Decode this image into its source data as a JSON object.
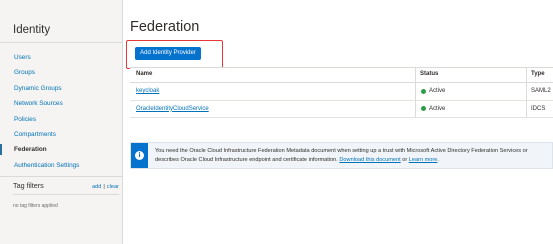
{
  "sidebar": {
    "title": "Identity",
    "items": [
      {
        "label": "Users"
      },
      {
        "label": "Groups"
      },
      {
        "label": "Dynamic Groups"
      },
      {
        "label": "Network Sources"
      },
      {
        "label": "Policies"
      },
      {
        "label": "Compartments"
      },
      {
        "label": "Federation",
        "active": true
      },
      {
        "label": "Authentication Settings"
      }
    ],
    "tag_filters": {
      "title": "Tag filters",
      "add_label": "add",
      "separator": "|",
      "clear_label": "clear",
      "empty_text": "no tag filters applied"
    }
  },
  "main": {
    "title": "Federation",
    "add_button_label": "Add Identity Provider",
    "table": {
      "columns": [
        "Name",
        "Status",
        "Type"
      ],
      "rows": [
        {
          "name": "keycloak",
          "status": "Active",
          "type": "SAML2"
        },
        {
          "name": "OracleIdentityCloudService",
          "status": "Active",
          "type": "IDCS"
        }
      ]
    },
    "banner": {
      "line1": "You need the Oracle Cloud Infrastructure Federation Metadata document when setting up a trust with Microsoft Active Directory Federation Services or",
      "line2_text": "describes Oracle Cloud Infrastructure endpoint and certificate information.",
      "download_link": "Download this document",
      "or_text": "or",
      "learn_more_link": "Learn more",
      "end_text": "."
    }
  },
  "colors": {
    "accent": "#0572ce",
    "link": "#0072b8",
    "status_active": "#2e9c48",
    "highlight": "#e53935"
  },
  "icons": {
    "banner_icon": "info-icon",
    "status_icon": "status-dot-icon"
  }
}
